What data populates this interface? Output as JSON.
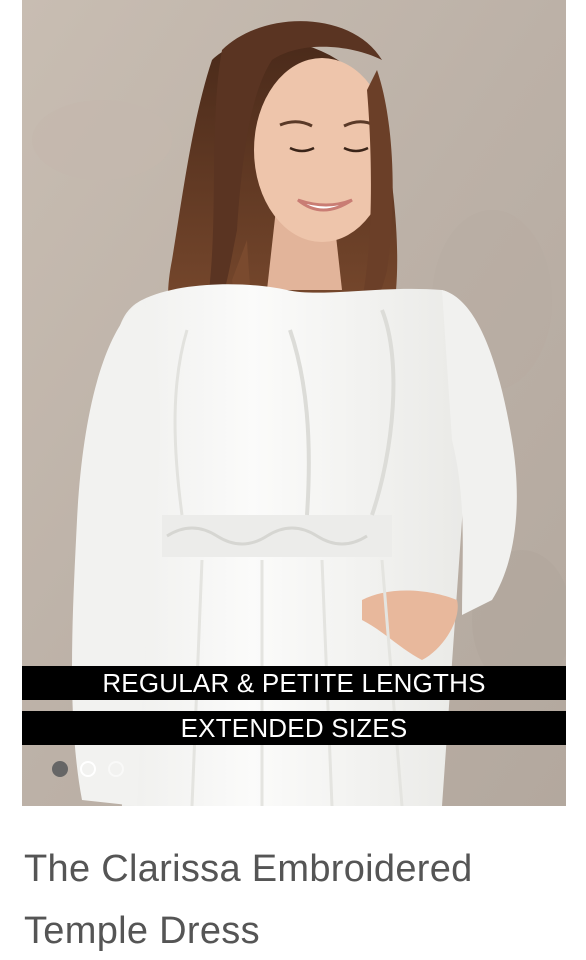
{
  "product": {
    "image_alt": "Woman wearing white embroidered long-sleeve temple dress",
    "banners": [
      "REGULAR & PETITE LENGTHS",
      "EXTENDED SIZES"
    ],
    "carousel": {
      "total": 3,
      "active_index": 0
    },
    "title": "The Clarissa Embroidered Temple Dress"
  },
  "colors": {
    "banner_bg": "#000000",
    "banner_text": "#ffffff",
    "wall": "#bfb4aa",
    "dress": "#f7f7f5",
    "hair": "#5a3422",
    "skin": "#e9bfa4",
    "title_text": "#555555",
    "dot_active": "#666666",
    "dot_border": "#ffffff"
  }
}
